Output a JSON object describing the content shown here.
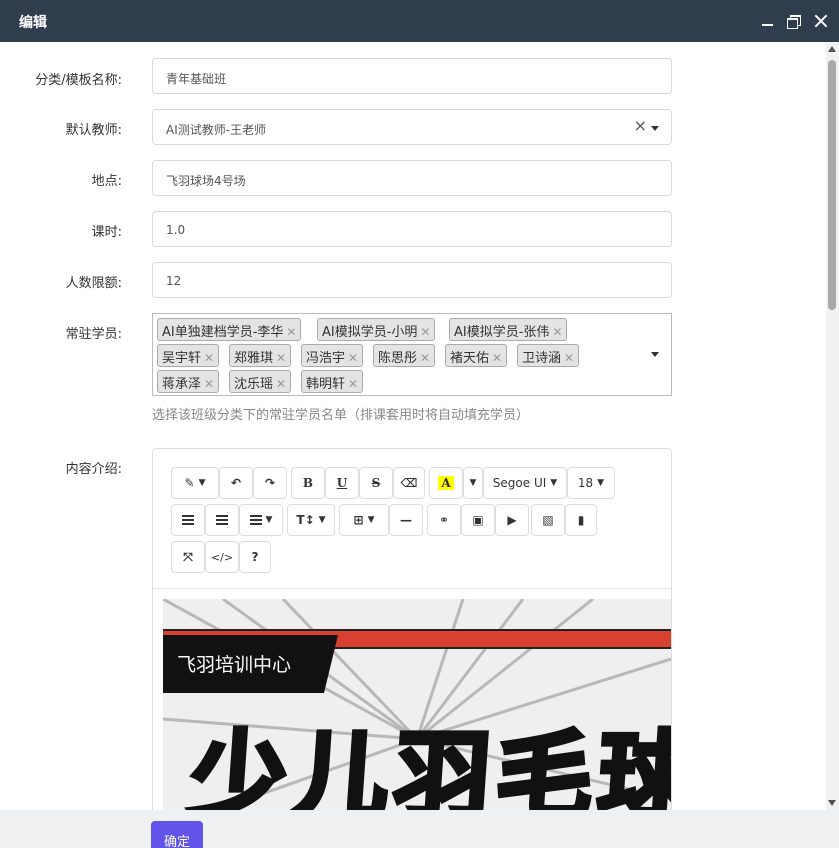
{
  "window": {
    "title": "编辑"
  },
  "form": {
    "name_label": "分类/模板名称:",
    "name_value": "青年基础班",
    "teacher_label": "默认教师:",
    "teacher_value": "AI测试教师-王老师",
    "teacher_clear": "×",
    "location_label": "地点:",
    "location_value": "飞羽球场4号场",
    "hours_label": "课时:",
    "hours_value": "1.0",
    "limit_label": "人数限额:",
    "limit_value": "12",
    "students_label": "常驻学员:",
    "students": [
      "AI单独建档学员-李华",
      "AI模拟学员-小明",
      "AI模拟学员-张伟",
      "吴宇轩",
      "郑雅琪",
      "冯浩宇",
      "陈思彤",
      "褚天佑",
      "卫诗涵",
      "蒋承泽",
      "沈乐瑶",
      "韩明轩"
    ],
    "students_help": "选择该班级分类下的常驻学员名单（排课套用时将自动填充学员）",
    "content_label": "内容介绍:"
  },
  "editor": {
    "toolbar": {
      "magic": "magic-wand-icon",
      "undo": "undo-icon",
      "redo": "redo-icon",
      "bold": "B",
      "underline": "U",
      "strike": "S",
      "eraser": "eraser-icon",
      "color": "A",
      "color_highlight": "#ffff00",
      "font_family": "Segoe UI",
      "font_size": "18",
      "ul": "unordered-list-icon",
      "ol": "ordered-list-icon",
      "align": "align-icon",
      "text_height": "T↕",
      "table": "table-icon",
      "hr": "horizontal-rule-icon",
      "link": "link-icon",
      "picture": "picture-icon",
      "video": "video-icon",
      "image_file": "image-file-icon",
      "file": "file-icon",
      "fullscreen": "fullscreen-icon",
      "code": "</>",
      "help": "?"
    },
    "poster": {
      "banner_text": "飞羽培训中心",
      "headline": "少儿羽毛球"
    }
  },
  "footer": {
    "confirm_label": "确定"
  },
  "colors": {
    "titlebar": "#2f3d4d",
    "primary_button": "#6254ea",
    "poster_red": "#d8412f"
  }
}
